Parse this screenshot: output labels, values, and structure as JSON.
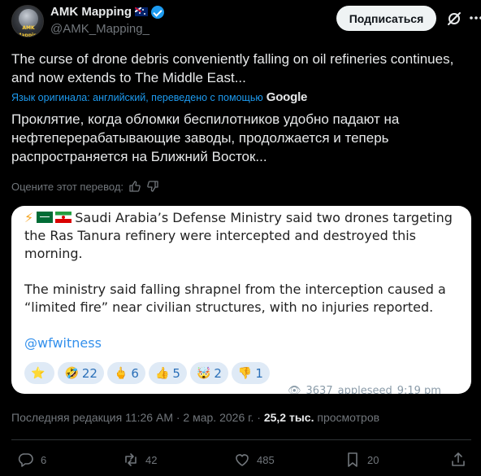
{
  "author": {
    "display_name": "AMK Mapping",
    "handle": "@AMK_Mapping_",
    "avatar_text": "AMK Mapping",
    "flag_icon": "flag-australia-icon",
    "verified_icon": "verified-badge-icon"
  },
  "header": {
    "subscribe_label": "Подписаться",
    "grok_icon": "grok-icon",
    "more_icon": "more-icon"
  },
  "tweet": {
    "original_text": "The curse of drone debris conveniently falling on oil refineries continues, and now extends to The Middle East...",
    "translation_note": "Язык оригинала: английский, переведено с помощью",
    "translation_provider": "Google",
    "translated_text": "Проклятие, когда обломки беспилотников удобно падают на нефтеперерабатывающие заводы, продолжается и теперь распространяется на Ближний Восток...",
    "rate_label": "Оцените этот перевод:"
  },
  "card": {
    "paragraph1": "Saudi Arabia’s Defense Ministry said two drones targeting the Ras Tanura refinery were intercepted and destroyed this morning.",
    "paragraph2": "The ministry said falling shrapnel from the interception caused a “limited fire” near civilian structures, with no injuries reported.",
    "mention": "@wfwitness",
    "reactions": [
      {
        "emoji": "⭐",
        "count": ""
      },
      {
        "emoji": "🤣",
        "count": "22"
      },
      {
        "emoji": "🖕",
        "count": "6"
      },
      {
        "emoji": "👍",
        "count": "5"
      },
      {
        "emoji": "🤯",
        "count": "2"
      },
      {
        "emoji": "👎",
        "count": "1"
      }
    ],
    "views": "3637",
    "source": "appleseed",
    "time": "9:19 pm"
  },
  "meta": {
    "edited_prefix": "Последняя редакция 11:26 AM · 2 мар. 2026 г. · ",
    "views_count": "25,2 тыс.",
    "views_label": " просмотров"
  },
  "actions": {
    "replies": "6",
    "reposts": "42",
    "likes": "485",
    "bookmarks": "20"
  },
  "colors": {
    "background": "#000000",
    "accent": "#1d9bf0",
    "muted": "#71767b",
    "text": "#e7e9ea"
  }
}
